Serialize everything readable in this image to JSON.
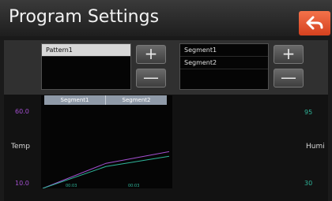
{
  "header": {
    "title": "Program Settings",
    "back_icon": "back-arrow-icon"
  },
  "patterns": {
    "items": [
      "Pattern1"
    ],
    "selected": "Pattern1"
  },
  "segments": {
    "items": [
      "Segment1",
      "Segment2"
    ]
  },
  "buttons": {
    "plus": "+",
    "minus": "—"
  },
  "chart": {
    "tabs": [
      "Segment1",
      "Segment2"
    ],
    "left_label": "Temp",
    "right_label": "Humi",
    "left_max": "60.0",
    "left_min": "10.0",
    "right_max": "95",
    "right_min": "30",
    "x_ticks": [
      "00:03",
      "00:03"
    ]
  },
  "chart_data": {
    "type": "line",
    "x": [
      0,
      1,
      2
    ],
    "series": [
      {
        "values": [
          10.0,
          25.0,
          32.0
        ]
      },
      {
        "values": [
          30,
          47,
          55
        ]
      }
    ],
    "ylim_left": [
      10.0,
      60.0
    ],
    "ylim_right": [
      30,
      95
    ],
    "colors": {
      "temp": "#a34fd0",
      "humi": "#2fb59a"
    }
  },
  "colors": {
    "accent": "#e9542d",
    "temp": "#a34fd0",
    "humi": "#2fb59a"
  }
}
